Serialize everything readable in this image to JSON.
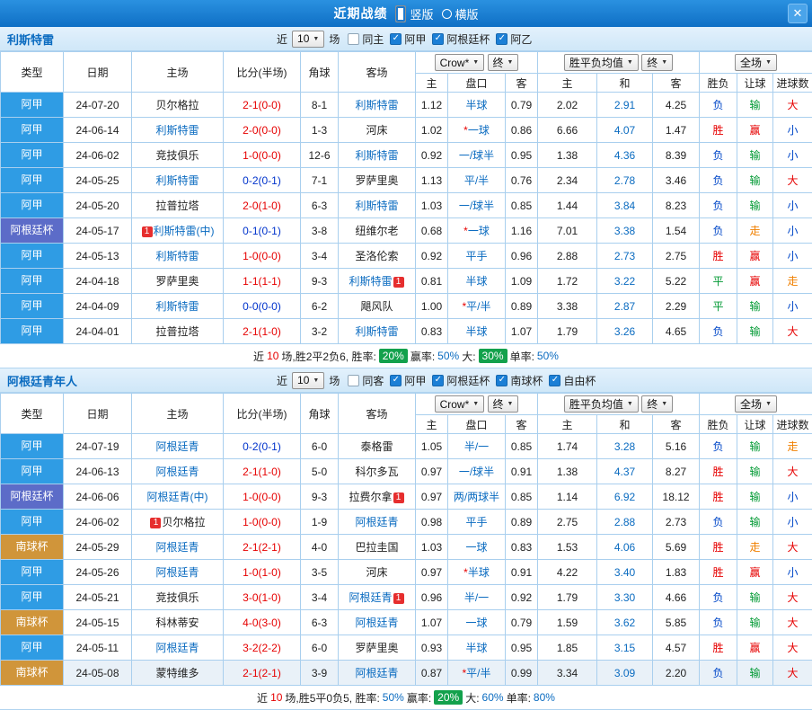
{
  "top_bar": {
    "title": "近期战绩",
    "radio_vertical": "竖版",
    "radio_horizontal": "横版"
  },
  "icons": {
    "chevron_down": "▼",
    "check": "✓",
    "close": "✕"
  },
  "filter_bar": {
    "near": "近",
    "count": "10",
    "games": "场"
  },
  "selects": {
    "company": "Crow*",
    "final": "终",
    "avg": "胜平负均值",
    "full": "全场"
  },
  "columns": {
    "type": "类型",
    "date": "日期",
    "home": "主场",
    "score": "比分(半场)",
    "corner": "角球",
    "away": "客场",
    "odds_home": "主",
    "odds_line": "盘口",
    "odds_away": "客",
    "eu_home": "主",
    "eu_draw": "和",
    "eu_away": "客",
    "result": "胜负",
    "handicap": "让球",
    "goals": "进球数"
  },
  "colors": {
    "league": {
      "阿甲": "#2f9ce4",
      "阿根廷杯": "#5c6cc8",
      "南球杯": "#d0953a"
    },
    "score": {
      "r": "#e60000",
      "b": "#0033cc",
      "g": "#009933"
    },
    "result": {
      "胜": "#e60000",
      "负": "#0047c8",
      "平": "#009933",
      "赢": "#e60000",
      "输": "#009933",
      "走": "#f08000",
      "大": "#e60000",
      "小": "#0047c8"
    }
  },
  "sections": [
    {
      "team": "利斯特雷",
      "filters": [
        {
          "label": "同主",
          "checked": false
        },
        {
          "label": "阿甲",
          "checked": true
        },
        {
          "label": "阿根廷杯",
          "checked": true
        },
        {
          "label": "阿乙",
          "checked": true
        }
      ],
      "rows": [
        {
          "league": "阿甲",
          "date": "24-07-20",
          "home": {
            "name": "贝尔格拉",
            "focus": false
          },
          "score": "2-1(0-0)",
          "sc": "r",
          "corner": "8-1",
          "away": {
            "name": "利斯特雷",
            "focus": true
          },
          "ah": [
            "1.12",
            "半球",
            "0.79"
          ],
          "eu": [
            "2.02",
            "2.91",
            "4.25"
          ],
          "res": [
            "负",
            "输",
            "大"
          ]
        },
        {
          "league": "阿甲",
          "date": "24-06-14",
          "home": {
            "name": "利斯特雷",
            "focus": true
          },
          "score": "2-0(0-0)",
          "sc": "r",
          "corner": "1-3",
          "away": {
            "name": "河床",
            "focus": false
          },
          "ah": [
            "1.02",
            "*一球",
            "0.86"
          ],
          "eu": [
            "6.66",
            "4.07",
            "1.47"
          ],
          "res": [
            "胜",
            "赢",
            "小"
          ]
        },
        {
          "league": "阿甲",
          "date": "24-06-02",
          "home": {
            "name": "竞技俱乐",
            "focus": false
          },
          "score": "1-0(0-0)",
          "sc": "r",
          "corner": "12-6",
          "away": {
            "name": "利斯特雷",
            "focus": true
          },
          "ah": [
            "0.92",
            "一/球半",
            "0.95"
          ],
          "eu": [
            "1.38",
            "4.36",
            "8.39"
          ],
          "res": [
            "负",
            "输",
            "小"
          ]
        },
        {
          "league": "阿甲",
          "date": "24-05-25",
          "home": {
            "name": "利斯特雷",
            "focus": true
          },
          "score": "0-2(0-1)",
          "sc": "b",
          "corner": "7-1",
          "away": {
            "name": "罗萨里奥",
            "focus": false
          },
          "ah": [
            "1.13",
            "平/半",
            "0.76"
          ],
          "eu": [
            "2.34",
            "2.78",
            "3.46"
          ],
          "res": [
            "负",
            "输",
            "大"
          ]
        },
        {
          "league": "阿甲",
          "date": "24-05-20",
          "home": {
            "name": "拉普拉塔",
            "focus": false
          },
          "score": "2-0(1-0)",
          "sc": "r",
          "corner": "6-3",
          "away": {
            "name": "利斯特雷",
            "focus": true
          },
          "ah": [
            "1.03",
            "一/球半",
            "0.85"
          ],
          "eu": [
            "1.44",
            "3.84",
            "8.23"
          ],
          "res": [
            "负",
            "输",
            "小"
          ]
        },
        {
          "league": "阿根廷杯",
          "date": "24-05-17",
          "home": {
            "name": "利斯特雷(中)",
            "focus": true,
            "badge": "pre",
            "badge_text": "1"
          },
          "score": "0-1(0-1)",
          "sc": "b",
          "corner": "3-8",
          "away": {
            "name": "纽维尔老",
            "focus": false
          },
          "ah": [
            "0.68",
            "*一球",
            "1.16"
          ],
          "eu": [
            "7.01",
            "3.38",
            "1.54"
          ],
          "res": [
            "负",
            "走",
            "小"
          ]
        },
        {
          "league": "阿甲",
          "date": "24-05-13",
          "home": {
            "name": "利斯特雷",
            "focus": true
          },
          "score": "1-0(0-0)",
          "sc": "r",
          "corner": "3-4",
          "away": {
            "name": "圣洛伦索",
            "focus": false
          },
          "ah": [
            "0.92",
            "平手",
            "0.96"
          ],
          "eu": [
            "2.88",
            "2.73",
            "2.75"
          ],
          "res": [
            "胜",
            "赢",
            "小"
          ]
        },
        {
          "league": "阿甲",
          "date": "24-04-18",
          "home": {
            "name": "罗萨里奥",
            "focus": false
          },
          "score": "1-1(1-1)",
          "sc": "r",
          "corner": "9-3",
          "away": {
            "name": "利斯特雷",
            "focus": true,
            "badge": "post",
            "badge_text": "1"
          },
          "ah": [
            "0.81",
            "半球",
            "1.09"
          ],
          "eu": [
            "1.72",
            "3.22",
            "5.22"
          ],
          "res": [
            "平",
            "赢",
            "走"
          ]
        },
        {
          "league": "阿甲",
          "date": "24-04-09",
          "home": {
            "name": "利斯特雷",
            "focus": true
          },
          "score": "0-0(0-0)",
          "sc": "b",
          "corner": "6-2",
          "away": {
            "name": "飓风队",
            "focus": false
          },
          "ah": [
            "1.00",
            "*平/半",
            "0.89"
          ],
          "eu": [
            "3.38",
            "2.87",
            "2.29"
          ],
          "res": [
            "平",
            "输",
            "小"
          ]
        },
        {
          "league": "阿甲",
          "date": "24-04-01",
          "home": {
            "name": "拉普拉塔",
            "focus": false
          },
          "score": "2-1(1-0)",
          "sc": "r",
          "corner": "3-2",
          "away": {
            "name": "利斯特雷",
            "focus": true
          },
          "ah": [
            "0.83",
            "半球",
            "1.07"
          ],
          "eu": [
            "1.79",
            "3.26",
            "4.65"
          ],
          "res": [
            "负",
            "输",
            "大"
          ]
        }
      ],
      "summary": [
        {
          "text": "近",
          "style": "plain"
        },
        {
          "text": "10",
          "style": "red"
        },
        {
          "text": "场,胜2平2负6, 胜率: ",
          "style": "plain"
        },
        {
          "text": "20%",
          "style": "badge"
        },
        {
          "text": " 赢率:",
          "style": "plain"
        },
        {
          "text": "50%",
          "style": "blue"
        },
        {
          "text": " 大: ",
          "style": "plain"
        },
        {
          "text": "30%",
          "style": "badge"
        },
        {
          "text": " 单率:",
          "style": "plain"
        },
        {
          "text": "50%",
          "style": "blue"
        }
      ]
    },
    {
      "team": "阿根廷青年人",
      "filters": [
        {
          "label": "同客",
          "checked": false
        },
        {
          "label": "阿甲",
          "checked": true
        },
        {
          "label": "阿根廷杯",
          "checked": true
        },
        {
          "label": "南球杯",
          "checked": true
        },
        {
          "label": "自由杯",
          "checked": true
        }
      ],
      "rows": [
        {
          "league": "阿甲",
          "date": "24-07-19",
          "home": {
            "name": "阿根廷青",
            "focus": true
          },
          "score": "0-2(0-1)",
          "sc": "b",
          "corner": "6-0",
          "away": {
            "name": "泰格雷",
            "focus": false
          },
          "ah": [
            "1.05",
            "半/一",
            "0.85"
          ],
          "eu": [
            "1.74",
            "3.28",
            "5.16"
          ],
          "res": [
            "负",
            "输",
            "走"
          ]
        },
        {
          "league": "阿甲",
          "date": "24-06-13",
          "home": {
            "name": "阿根廷青",
            "focus": true
          },
          "score": "2-1(1-0)",
          "sc": "r",
          "corner": "5-0",
          "away": {
            "name": "科尔多瓦",
            "focus": false
          },
          "ah": [
            "0.97",
            "一/球半",
            "0.91"
          ],
          "eu": [
            "1.38",
            "4.37",
            "8.27"
          ],
          "res": [
            "胜",
            "输",
            "大"
          ]
        },
        {
          "league": "阿根廷杯",
          "date": "24-06-06",
          "home": {
            "name": "阿根廷青(中)",
            "focus": true
          },
          "score": "1-0(0-0)",
          "sc": "r",
          "corner": "9-3",
          "away": {
            "name": "拉费尔拿",
            "focus": false,
            "badge": "post",
            "badge_text": "1"
          },
          "ah": [
            "0.97",
            "两/两球半",
            "0.85"
          ],
          "eu": [
            "1.14",
            "6.92",
            "18.12"
          ],
          "res": [
            "胜",
            "输",
            "小"
          ]
        },
        {
          "league": "阿甲",
          "date": "24-06-02",
          "home": {
            "name": "贝尔格拉",
            "focus": false,
            "badge": "pre",
            "badge_text": "1"
          },
          "score": "1-0(0-0)",
          "sc": "r",
          "corner": "1-9",
          "away": {
            "name": "阿根廷青",
            "focus": true
          },
          "ah": [
            "0.98",
            "平手",
            "0.89"
          ],
          "eu": [
            "2.75",
            "2.88",
            "2.73"
          ],
          "res": [
            "负",
            "输",
            "小"
          ]
        },
        {
          "league": "南球杯",
          "date": "24-05-29",
          "home": {
            "name": "阿根廷青",
            "focus": true
          },
          "score": "2-1(2-1)",
          "sc": "r",
          "corner": "4-0",
          "away": {
            "name": "巴拉圭国",
            "focus": false
          },
          "ah": [
            "1.03",
            "一球",
            "0.83"
          ],
          "eu": [
            "1.53",
            "4.06",
            "5.69"
          ],
          "res": [
            "胜",
            "走",
            "大"
          ]
        },
        {
          "league": "阿甲",
          "date": "24-05-26",
          "home": {
            "name": "阿根廷青",
            "focus": true
          },
          "score": "1-0(1-0)",
          "sc": "r",
          "corner": "3-5",
          "away": {
            "name": "河床",
            "focus": false
          },
          "ah": [
            "0.97",
            "*半球",
            "0.91"
          ],
          "eu": [
            "4.22",
            "3.40",
            "1.83"
          ],
          "res": [
            "胜",
            "赢",
            "小"
          ]
        },
        {
          "league": "阿甲",
          "date": "24-05-21",
          "home": {
            "name": "竞技俱乐",
            "focus": false
          },
          "score": "3-0(1-0)",
          "sc": "r",
          "corner": "3-4",
          "away": {
            "name": "阿根廷青",
            "focus": true,
            "badge": "post",
            "badge_text": "1"
          },
          "ah": [
            "0.96",
            "半/一",
            "0.92"
          ],
          "eu": [
            "1.79",
            "3.30",
            "4.66"
          ],
          "res": [
            "负",
            "输",
            "大"
          ]
        },
        {
          "league": "南球杯",
          "date": "24-05-15",
          "home": {
            "name": "科林蒂安",
            "focus": false
          },
          "score": "4-0(3-0)",
          "sc": "r",
          "corner": "6-3",
          "away": {
            "name": "阿根廷青",
            "focus": true
          },
          "ah": [
            "1.07",
            "一球",
            "0.79"
          ],
          "eu": [
            "1.59",
            "3.62",
            "5.85"
          ],
          "res": [
            "负",
            "输",
            "大"
          ]
        },
        {
          "league": "阿甲",
          "date": "24-05-11",
          "home": {
            "name": "阿根廷青",
            "focus": true
          },
          "score": "3-2(2-2)",
          "sc": "r",
          "corner": "6-0",
          "away": {
            "name": "罗萨里奥",
            "focus": false
          },
          "ah": [
            "0.93",
            "半球",
            "0.95"
          ],
          "eu": [
            "1.85",
            "3.15",
            "4.57"
          ],
          "res": [
            "胜",
            "赢",
            "大"
          ]
        },
        {
          "league": "南球杯",
          "date": "24-05-08",
          "home": {
            "name": "蒙特维多",
            "focus": false
          },
          "score": "2-1(2-1)",
          "sc": "r",
          "corner": "3-9",
          "away": {
            "name": "阿根廷青",
            "focus": true
          },
          "ah": [
            "0.87",
            "*平/半",
            "0.99"
          ],
          "eu": [
            "3.34",
            "3.09",
            "2.20"
          ],
          "res": [
            "负",
            "输",
            "大"
          ],
          "hl": true
        }
      ],
      "summary": [
        {
          "text": "近",
          "style": "plain"
        },
        {
          "text": "10",
          "style": "red"
        },
        {
          "text": "场,胜5平0负5, 胜率:",
          "style": "plain"
        },
        {
          "text": "50%",
          "style": "blue"
        },
        {
          "text": " 赢率: ",
          "style": "plain"
        },
        {
          "text": "20%",
          "style": "badge"
        },
        {
          "text": " 大:",
          "style": "plain"
        },
        {
          "text": "60%",
          "style": "blue"
        },
        {
          "text": " 单率:",
          "style": "plain"
        },
        {
          "text": "80%",
          "style": "blue"
        }
      ]
    }
  ]
}
